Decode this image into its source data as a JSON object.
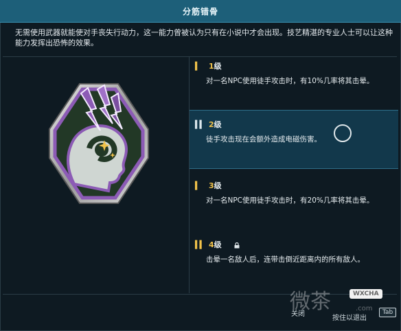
{
  "title": "分筋错骨",
  "description": "无需使用武器就能使对手丧失行动力，这一能力曾被认为只有在小说中才会出现。技艺精湛的专业人士可以让这种能力发挥出恐怖的效果。",
  "tiers": [
    {
      "level_num": "1",
      "level_suffix": "级",
      "text": "对一名NPC使用徒手攻击时，有10%几率将其击晕。"
    },
    {
      "level_num": "2",
      "level_suffix": "级",
      "text": "徒手攻击现在会额外造成电磁伤害。"
    },
    {
      "level_num": "3",
      "level_suffix": "级",
      "text": "对一名NPC使用徒手攻击时，有20%几率将其击晕。"
    },
    {
      "level_num": "4",
      "level_suffix": "级",
      "text": "击晕一名敌人后，连带击倒近距离内的所有敌人。"
    }
  ],
  "footer": {
    "close_label": "关闭",
    "close_key": "Tab",
    "hint_label": "按住以退出"
  },
  "watermark": {
    "chinese": "微茶",
    "brand": "WXCHA",
    "suffix": ".com"
  },
  "colors": {
    "title_bar": "#1d5f79",
    "background": "#0e1a22",
    "active_row": "#12384b",
    "level_accent": "#f1c24a",
    "badge_purple": "#8c5bb5"
  },
  "icons": [
    "perk-badge-icon",
    "lock-icon",
    "cursor-circle-icon"
  ]
}
